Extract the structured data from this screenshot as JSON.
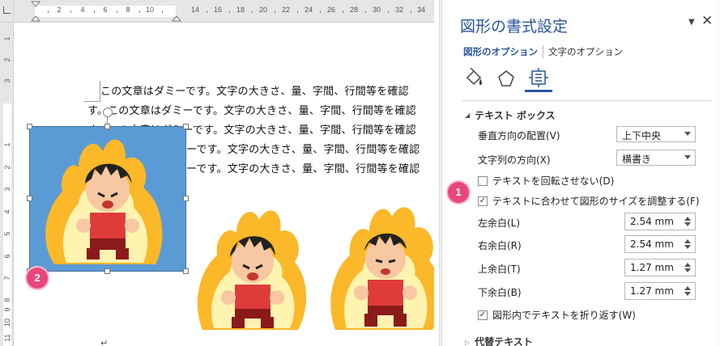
{
  "ruler": {
    "h_ticks": [
      "2",
      "4",
      "6",
      "8",
      "10",
      "14",
      "16",
      "18",
      "20",
      "22",
      "24",
      "26",
      "28",
      "30",
      "32",
      "34"
    ],
    "v_ticks": [
      "1",
      "2",
      "3",
      "1",
      "2",
      "3",
      "4",
      "5",
      "6",
      "7",
      "8",
      "9",
      "10",
      "11"
    ]
  },
  "document": {
    "lines": [
      "この文章はダミーです。文字の大きさ、量、字間、行間等を確認",
      "す。この文章はダミーです。文字の大きさ、量、字間、行間等を確認",
      "す。この文章はダミーです。文字の大きさ、量、字間、行間等を確認",
      "ーです。文字の大きさ、量、字間、行間等を確認",
      "ーです。文字の大きさ、量、字間、行間等を確認"
    ],
    "para_mark": "↵"
  },
  "badges": {
    "one": "1",
    "two": "2"
  },
  "pane": {
    "title": "図形の書式設定",
    "close_glyph": "✕",
    "dropdown_glyph": "▼",
    "tabs": {
      "shape_options": "図形のオプション",
      "text_options": "文字のオプション"
    },
    "icons": [
      "fill-line-icon",
      "effects-pentagon-icon",
      "layout-properties-icon"
    ],
    "textbox_section": {
      "header": "テキスト ボックス",
      "vertical_align_label": "垂直方向の配置(V)",
      "vertical_align_value": "上下中央",
      "text_direction_label": "文字列の方向(X)",
      "text_direction_value": "横書き",
      "no_rotate_label": "テキストを回転させない(D)",
      "no_rotate_checked": false,
      "autofit_label": "テキストに合わせて図形のサイズを調整する(F)",
      "autofit_checked": true,
      "left_margin_label": "左余白(L)",
      "left_margin_value": "2.54 mm",
      "right_margin_label": "右余白(R)",
      "right_margin_value": "2.54 mm",
      "top_margin_label": "上余白(T)",
      "top_margin_value": "1.27 mm",
      "bottom_margin_label": "下余白(B)",
      "bottom_margin_value": "1.27 mm",
      "wrap_label": "図形内でテキストを折り返す(W)",
      "wrap_checked": true
    },
    "alt_text_section": {
      "header": "代替テキスト"
    }
  },
  "colors": {
    "accent": "#2b579a",
    "shape_fill": "#5b9bd5",
    "badge": "#e8467c"
  }
}
